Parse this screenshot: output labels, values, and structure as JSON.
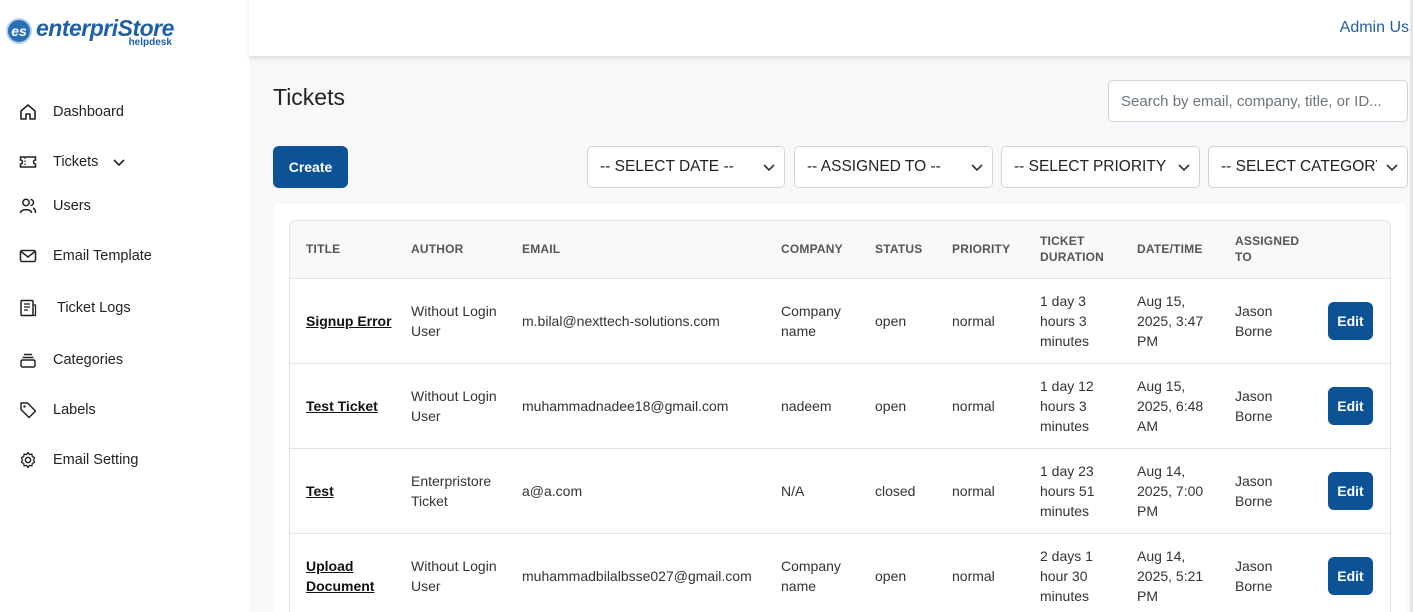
{
  "brand": {
    "mark": "es",
    "name": "enterpriStore",
    "sub": "helpdesk"
  },
  "header": {
    "user": "Admin Us"
  },
  "sidebar": {
    "items": [
      {
        "label": "Dashboard",
        "icon": "home-icon"
      },
      {
        "label": "Tickets",
        "icon": "ticket-icon"
      },
      {
        "label": "Users",
        "icon": "users-icon"
      },
      {
        "label": "Email Template",
        "icon": "envelope-icon"
      },
      {
        "label": "Ticket Logs",
        "icon": "logs-icon"
      },
      {
        "label": "Categories",
        "icon": "categories-icon"
      },
      {
        "label": "Labels",
        "icon": "tag-icon"
      },
      {
        "label": "Email Setting",
        "icon": "gear-icon"
      }
    ]
  },
  "page": {
    "title": "Tickets",
    "search_placeholder": "Search by email, company, title, or ID...",
    "create_label": "Create"
  },
  "filters": [
    {
      "label": "-- SELECT DATE --"
    },
    {
      "label": "-- ASSIGNED TO --"
    },
    {
      "label": "-- SELECT PRIORITY --"
    },
    {
      "label": "-- SELECT CATEGORY --"
    }
  ],
  "table": {
    "columns": [
      "TITLE",
      "AUTHOR",
      "EMAIL",
      "COMPANY",
      "STATUS",
      "PRIORITY",
      "TICKET DURATION",
      "DATE/TIME",
      "ASSIGNED TO",
      ""
    ],
    "edit_label": "Edit",
    "rows": [
      {
        "title": "Signup Error",
        "author": "Without Login User",
        "email": "m.bilal@nexttech-solutions.com",
        "company": "Company name",
        "status": "open",
        "priority": "normal",
        "duration": "1 day 3 hours 3 minutes",
        "datetime": "Aug 15, 2025, 3:47 PM",
        "assigned": "Jason Borne"
      },
      {
        "title": "Test Ticket",
        "author": "Without Login User",
        "email": "muhammadnadee18@gmail.com",
        "company": "nadeem",
        "status": "open",
        "priority": "normal",
        "duration": "1 day 12 hours 3 minutes",
        "datetime": "Aug 15, 2025, 6:48 AM",
        "assigned": "Jason Borne"
      },
      {
        "title": "Test",
        "author": "Enterpristore Ticket",
        "email": "a@a.com",
        "company": "N/A",
        "status": "closed",
        "priority": "normal",
        "duration": "1 day 23 hours 51 minutes",
        "datetime": "Aug 14, 2025, 7:00 PM",
        "assigned": "Jason Borne"
      },
      {
        "title": "Upload Document",
        "author": "Without Login User",
        "email": "muhammadbilalbsse027@gmail.com",
        "company": "Company name",
        "status": "open",
        "priority": "normal",
        "duration": "2 days 1 hour 30 minutes",
        "datetime": "Aug 14, 2025, 5:21 PM",
        "assigned": "Jason Borne"
      }
    ]
  }
}
